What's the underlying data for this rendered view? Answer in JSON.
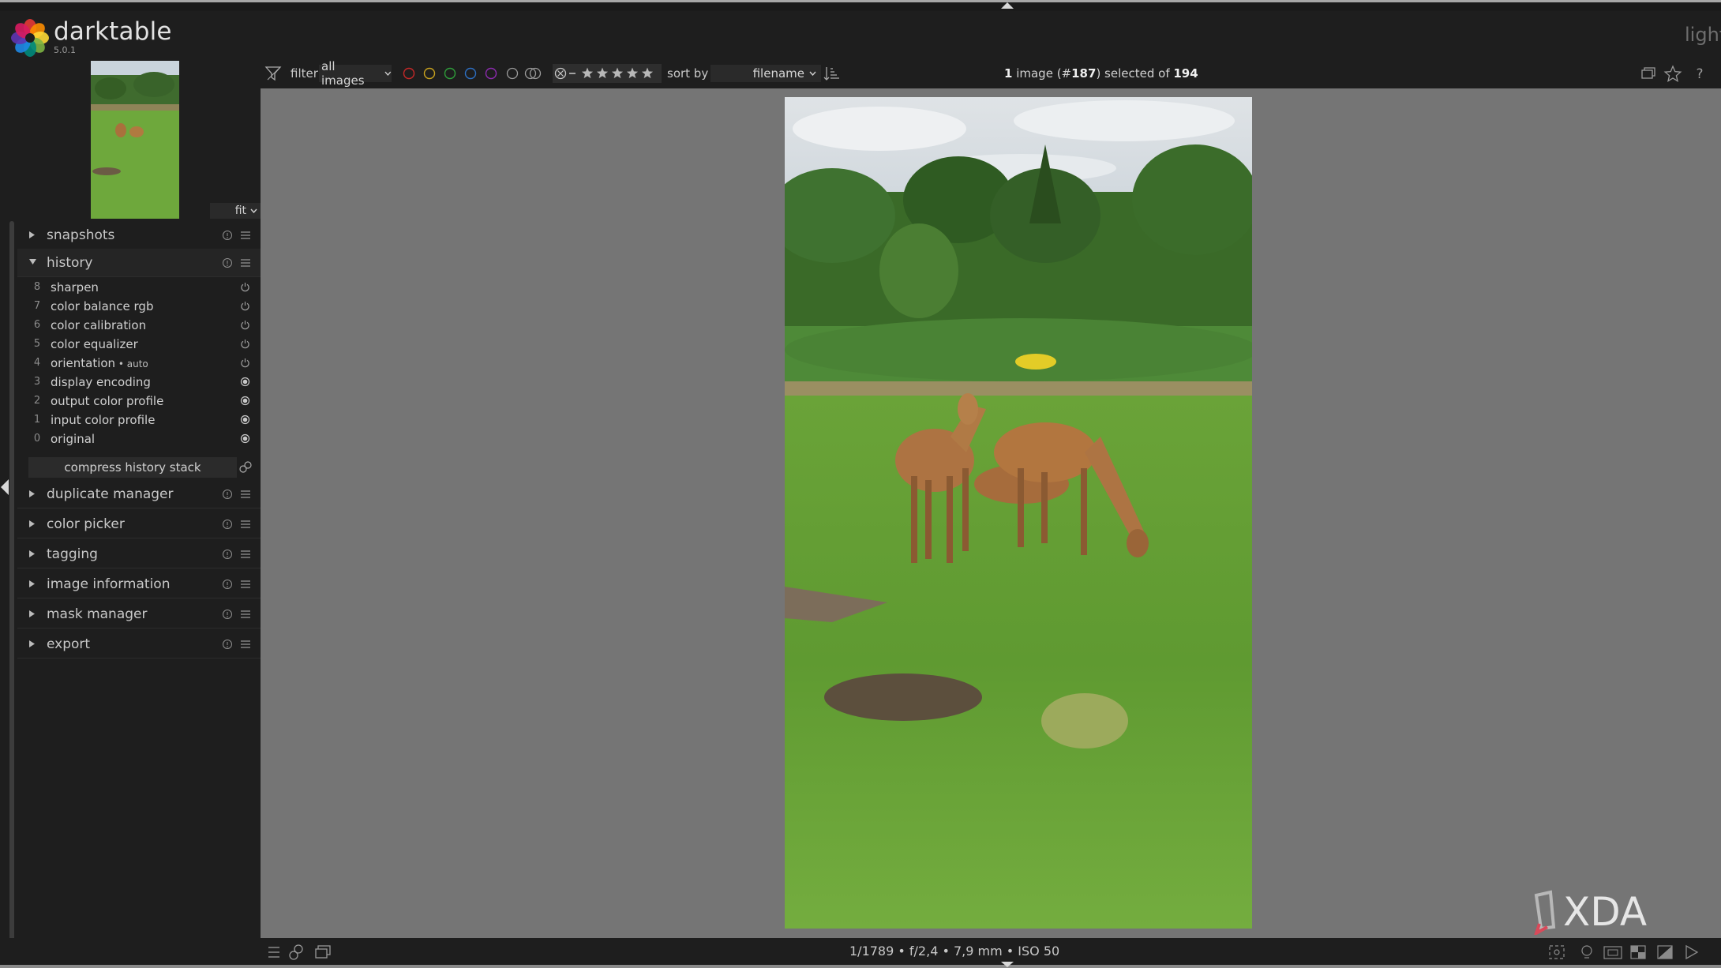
{
  "app": {
    "name": "darktable",
    "version": "5.0.1",
    "view": "light"
  },
  "left_panel": {
    "zoom": "fit",
    "modules": [
      {
        "label": "snapshots"
      },
      {
        "label": "history"
      },
      {
        "label": "duplicate manager"
      },
      {
        "label": "color picker"
      },
      {
        "label": "tagging"
      },
      {
        "label": "image information"
      },
      {
        "label": "mask manager"
      },
      {
        "label": "export"
      }
    ],
    "history": [
      {
        "num": "8",
        "name": "sharpen",
        "state": "power"
      },
      {
        "num": "7",
        "name": "color balance rgb",
        "state": "power"
      },
      {
        "num": "6",
        "name": "color calibration",
        "state": "power"
      },
      {
        "num": "5",
        "name": "color equalizer",
        "state": "power"
      },
      {
        "num": "4",
        "name": "orientation",
        "suffix": " • auto",
        "state": "power"
      },
      {
        "num": "3",
        "name": "display encoding",
        "state": "always-on"
      },
      {
        "num": "2",
        "name": "output color profile",
        "state": "always-on"
      },
      {
        "num": "1",
        "name": "input color profile",
        "state": "always-on"
      },
      {
        "num": "0",
        "name": "original",
        "state": "always-on"
      }
    ],
    "compress_label": "compress history stack"
  },
  "filterbar": {
    "filter_label": "filter",
    "filter_value": "all images",
    "color_labels": [
      "#c62828",
      "#c8a21e",
      "#2e9e3a",
      "#2d6fc2",
      "#8d2bb0"
    ],
    "sort_label": "sort by",
    "sort_value": "filename",
    "count": {
      "prefix": "1",
      "middle1": " image (#",
      "image_no": "187",
      "middle2": ") selected of ",
      "total": "194"
    }
  },
  "bottombar": {
    "exif": "1/1789 • f/2,4 • 7,9 mm • ISO 50"
  },
  "watermark": "XDA",
  "colors": {
    "background": "#1e1e1e",
    "center": "#757575",
    "text": "#c8c8c8"
  }
}
